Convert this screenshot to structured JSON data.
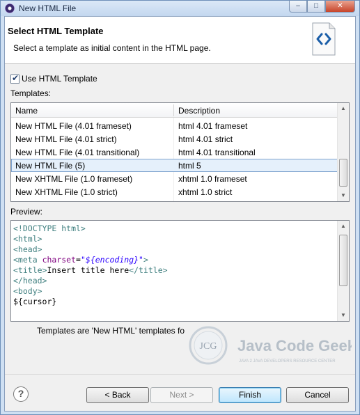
{
  "window": {
    "title": "New HTML File",
    "controls": {
      "minimize": "–",
      "maximize": "□",
      "close": "✕"
    }
  },
  "header": {
    "title": "Select HTML Template",
    "description": "Select a template as initial content in the HTML page."
  },
  "use_template": {
    "label": "Use HTML Template",
    "checked": true
  },
  "templates": {
    "label": "Templates:",
    "columns": [
      "Name",
      "Description"
    ],
    "rows": [
      {
        "name": "New HTML File (4.01 frameset)",
        "description": "html 4.01 frameset"
      },
      {
        "name": "New HTML File (4.01 strict)",
        "description": "html 4.01 strict"
      },
      {
        "name": "New HTML File (4.01 transitional)",
        "description": "html 4.01 transitional"
      },
      {
        "name": "New HTML File (5)",
        "description": "html 5",
        "selected": true
      },
      {
        "name": "New XHTML File (1.0 frameset)",
        "description": "xhtml 1.0 frameset"
      },
      {
        "name": "New XHTML File (1.0 strict)",
        "description": "xhtml 1.0 strict"
      }
    ]
  },
  "preview": {
    "label": "Preview:",
    "lines": [
      "<!DOCTYPE html>",
      "<html>",
      "<head>",
      "<meta charset=\"${encoding}\">",
      "<title>Insert title here</title>",
      "</head>",
      "<body>",
      "${cursor}"
    ]
  },
  "note": "Templates are 'New HTML' templates fo",
  "watermark": {
    "logo_text": "JCG",
    "brand": "Java Code Geeks",
    "tagline": "JAVA 2 JAVA DEVELOPERS RESOURCE CENTER"
  },
  "footer": {
    "help_label": "?",
    "back_label": "< Back",
    "next_label": "Next >",
    "finish_label": "Finish",
    "cancel_label": "Cancel"
  }
}
